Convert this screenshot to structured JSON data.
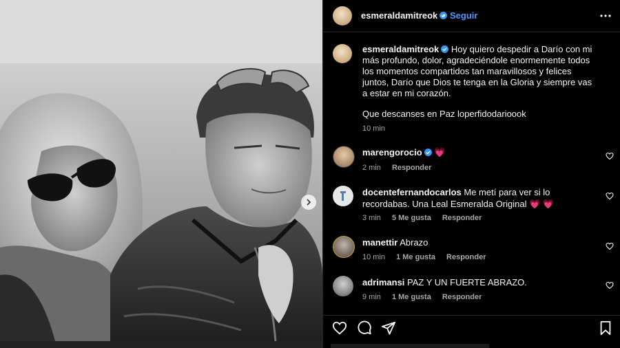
{
  "post": {
    "username": "esmeraldamitreok",
    "verified": true,
    "follow_label": "Seguir",
    "dot": "•"
  },
  "caption": {
    "username": "esmeraldamitreok",
    "text": " Hoy quiero despedir a Darío con mi más profundo, dolor, agradeciéndole enormemente todos los momentos compartidos tan maravillosos y felices juntos, Darío que Dios te tenga en la Gloria y siempre vas a estar en mi corazón.",
    "text2": "Que descanses en Paz loperfidodarioook",
    "time": "10 min"
  },
  "comments": [
    {
      "username": "marengorocio",
      "verified": true,
      "text": "💗",
      "time": "2 min",
      "likes": "",
      "reply": "Responder"
    },
    {
      "username": "docentefernandocarlos",
      "verified": false,
      "text": "Me metí para ver si lo recordabas. Una Leal Esmeralda Original 💗 💗",
      "time": "3 min",
      "likes": "5 Me gusta",
      "reply": "Responder"
    },
    {
      "username": "manettir",
      "verified": false,
      "text": "Abrazo",
      "time": "10 min",
      "likes": "1 Me gusta",
      "reply": "Responder"
    },
    {
      "username": "adrimansi",
      "verified": false,
      "text": "PAZ Y UN FUERTE ABRAZO.",
      "time": "9 min",
      "likes": "1 Me gusta",
      "reply": "Responder"
    }
  ],
  "icons": {
    "more": "more-options-icon",
    "like": "heart-icon",
    "comment": "comment-icon",
    "share": "share-icon",
    "save": "bookmark-icon",
    "next": "chevron-right-icon"
  },
  "colors": {
    "background": "#000000",
    "text": "#f5f5f5",
    "secondary": "#a8a8a8",
    "link": "#4c9bff",
    "verified": "#3897f0",
    "heart": "#ff3b7f"
  }
}
